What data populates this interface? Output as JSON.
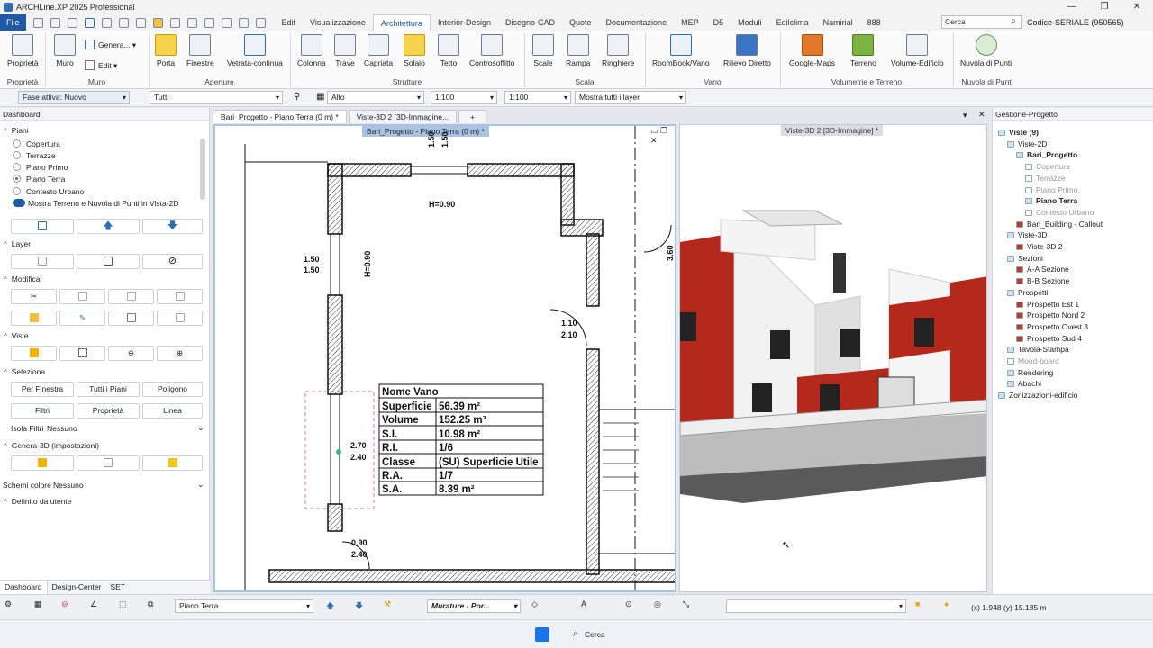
{
  "window": {
    "title": "ARCHLine.XP 2025 Professional",
    "minimize": "—",
    "maximize": "❐",
    "close": "✕"
  },
  "menu": {
    "file": "File",
    "tabs": [
      "Edit",
      "Visualizzazione",
      "Architettura",
      "Interior-Design",
      "Disegno-CAD",
      "Quote",
      "Documentazione",
      "MEP",
      "D5",
      "Moduli",
      "Edilclima",
      "Namirial",
      "888"
    ],
    "active_tab": "Architettura",
    "search_placeholder": "Cerca",
    "serial": "Codice-SERIALE (950565)"
  },
  "ribbon": {
    "buttons": {
      "proprieta": "Proprietà",
      "muro": "Muro",
      "genera": "Genera...",
      "edit": "Edit",
      "porta": "Porta",
      "finestre": "Finestre",
      "vetrata": "Vetrata-continua",
      "colonna": "Colonna",
      "trave": "Trave",
      "capriata": "Capriata",
      "solaio": "Solaio",
      "tetto": "Tetto",
      "controsoffitto": "Controsoffitto",
      "scale": "Scale",
      "rampa": "Rampa",
      "ringhiere": "Ringhiere",
      "roombook": "RoomBook/Vano",
      "rilievo": "Rilievo Diretto",
      "googlemaps": "Google-Maps",
      "terreno": "Terreno",
      "volume": "Volume-Edificio",
      "nuvola": "Nuvola di Punti"
    },
    "groups": {
      "proprieta": "Proprietà",
      "muro": "Muro",
      "aperture": "Aperture",
      "strutture": "Strutture",
      "scala": "Scala",
      "vano": "Vano",
      "volumetrie": "Volumetrie e Terreno",
      "nuvola": "Nuvola di Punti"
    }
  },
  "optionsbar": {
    "phase": "Fase attiva: Nuovo",
    "filter": "Tutti",
    "height": "Alto",
    "scale1": "1:100",
    "scale2": "1:100",
    "layers": "Mostra tutti i layer"
  },
  "left_panel": {
    "title": "Dashboard",
    "sections": {
      "piani": "Piani",
      "layer": "Layer",
      "modifica": "Modifica",
      "viste": "Viste",
      "seleziona": "Seleziona",
      "genera3d": "Genera-3D (impostazioni)",
      "definito": "Definito da utente"
    },
    "levels": [
      "Copertura",
      "Terrazze",
      "Piano Primo",
      "Piano Terra",
      "Contesto Urbano"
    ],
    "active_level": "Piano Terra",
    "toggle_label": "Mostra Terreno e Nuvola di Punti in Vista-2D",
    "select_buttons": [
      "Per Finestra",
      "Tutti i Piani",
      "Poligono",
      "Filtri",
      "Proprietà",
      "Linea"
    ],
    "isola_label": "Isola Filtri",
    "isola_value": "Nessuno",
    "schemi_label": "Schemi colore",
    "schemi_value": "Nessuno",
    "bottom_tabs": [
      "Dashboard",
      "Design-Center",
      "SET"
    ]
  },
  "documents": {
    "tabs": [
      "Bari_Progetto - Piano Terra (0 m) *",
      "Viste-3D 2 [3D-Immagine...",
      "+"
    ],
    "view2d_label": "Bari_Progetto - Piano Terra (0 m) *",
    "view3d_label": "Viste-3D 2 [3D-Immagine] *"
  },
  "drawing": {
    "dims": [
      "1.50",
      "1.50",
      "H=0.90",
      "1.50",
      "1.50",
      "H=0.90",
      "3.60",
      "1.10",
      "2.10",
      "2.70",
      "2.40",
      "0.90",
      "2.40"
    ],
    "room_table": [
      [
        "Nome Vano",
        ""
      ],
      [
        "Superficie",
        "56.39 m²"
      ],
      [
        "Volume",
        "152.25 m³"
      ],
      [
        "S.I.",
        "10.98 m²"
      ],
      [
        "R.I.",
        "1/6"
      ],
      [
        "Classe",
        "(SU) Superficie Utile"
      ],
      [
        "R.A.",
        "1/7"
      ],
      [
        "S.A.",
        "8.39 m²"
      ]
    ]
  },
  "right_panel": {
    "title": "Gestione-Progetto",
    "tree": [
      {
        "label": "Viste (9)",
        "bold": true,
        "indent": 0
      },
      {
        "label": "Viste-2D",
        "bold": false,
        "indent": 1
      },
      {
        "label": "Bari_Progetto",
        "bold": true,
        "indent": 2
      },
      {
        "label": "Copertura",
        "bold": false,
        "indent": 3,
        "muted": true
      },
      {
        "label": "Terrazze",
        "bold": false,
        "indent": 3,
        "muted": true
      },
      {
        "label": "Piano Primo",
        "bold": false,
        "indent": 3,
        "muted": true
      },
      {
        "label": "Piano Terra",
        "bold": true,
        "indent": 3
      },
      {
        "label": "Contesto Urbano",
        "bold": false,
        "indent": 3,
        "muted": true
      },
      {
        "label": "Bari_Building - Callout",
        "bold": false,
        "indent": 2
      },
      {
        "label": "Viste-3D",
        "bold": false,
        "indent": 1
      },
      {
        "label": "Viste-3D 2",
        "bold": false,
        "indent": 2
      },
      {
        "label": "Sezioni",
        "bold": false,
        "indent": 1
      },
      {
        "label": "A-A Sezione",
        "bold": false,
        "indent": 2
      },
      {
        "label": "B-B Sezione",
        "bold": false,
        "indent": 2
      },
      {
        "label": "Prospetti",
        "bold": false,
        "indent": 1
      },
      {
        "label": "Prospetto Est 1",
        "bold": false,
        "indent": 2
      },
      {
        "label": "Prospetto Nord 2",
        "bold": false,
        "indent": 2
      },
      {
        "label": "Prospetto Ovest 3",
        "bold": false,
        "indent": 2
      },
      {
        "label": "Prospetto Sud 4",
        "bold": false,
        "indent": 2
      },
      {
        "label": "Tavola-Stampa",
        "bold": false,
        "indent": 1
      },
      {
        "label": "Mood-board",
        "bold": false,
        "indent": 1,
        "muted": true
      },
      {
        "label": "Rendering",
        "bold": false,
        "indent": 1
      },
      {
        "label": "Abachi",
        "bold": false,
        "indent": 1
      },
      {
        "label": "Zonizzazioni-edificio",
        "bold": false,
        "indent": 0
      }
    ]
  },
  "statusbar": {
    "level": "Piano Terra",
    "material": "Murature - Por...",
    "coords": "(x) 1.948   (y) 15.185 m"
  },
  "taskbar": {
    "search": "Cerca"
  }
}
